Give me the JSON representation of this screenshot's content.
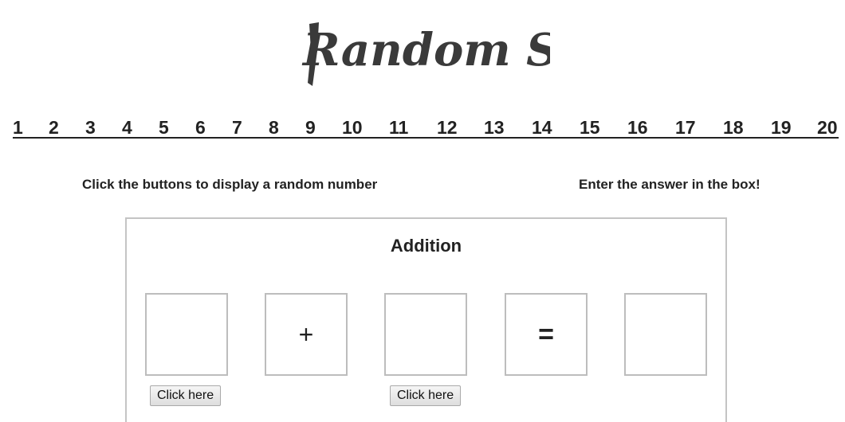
{
  "header": {
    "title": "Random Sums"
  },
  "nav": {
    "numbers": [
      "1",
      "2",
      "3",
      "4",
      "5",
      "6",
      "7",
      "8",
      "9",
      "10",
      "11",
      "12",
      "13",
      "14",
      "15",
      "16",
      "17",
      "18",
      "19",
      "20"
    ]
  },
  "instructions": {
    "left": "Click the buttons to display a random number",
    "right": "Enter the answer in the box!"
  },
  "panel": {
    "title": "Addition",
    "operator": "+",
    "equals": "=",
    "number_1": "",
    "number_2": "",
    "answer": "",
    "button_1_label": "Click here",
    "button_2_label": "Click here"
  }
}
